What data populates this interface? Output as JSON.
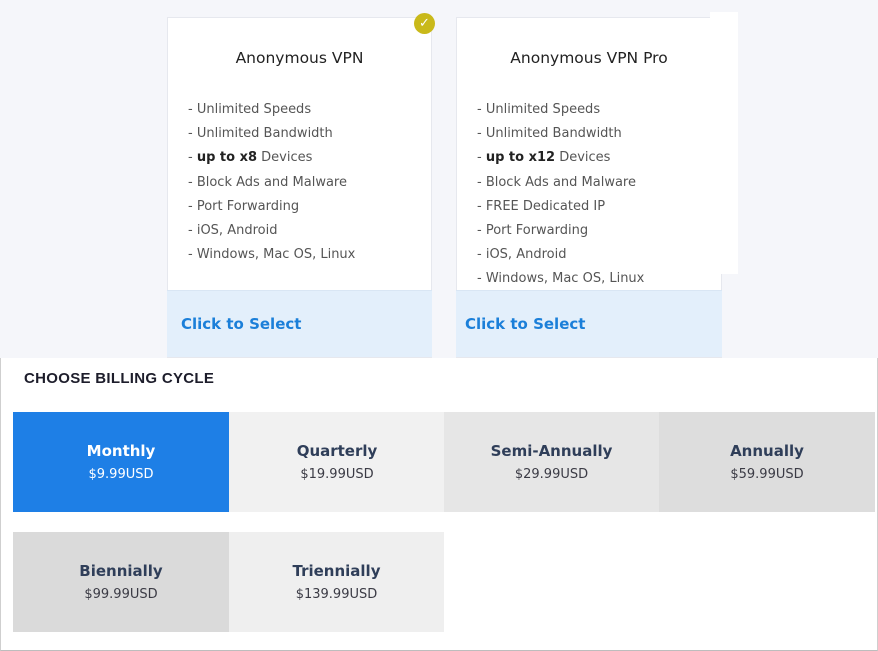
{
  "plans": [
    {
      "title": "Anonymous VPN",
      "features": [
        {
          "prefix": "- ",
          "text": "Unlimited Speeds"
        },
        {
          "prefix": "- ",
          "text": "Unlimited Bandwidth"
        },
        {
          "prefix": "- ",
          "bold": "up to x8",
          "text": " Devices"
        },
        {
          "prefix": "- ",
          "text": "Block Ads and Malware"
        },
        {
          "prefix": "- ",
          "text": "Port Forwarding"
        },
        {
          "prefix": "- ",
          "text": "iOS, Android"
        },
        {
          "prefix": "- ",
          "text": "Windows, Mac OS, Linux"
        }
      ],
      "select_label": "Click to Select",
      "selected": true
    },
    {
      "title": "Anonymous VPN Pro",
      "features": [
        {
          "prefix": "- ",
          "text": "Unlimited Speeds"
        },
        {
          "prefix": "- ",
          "text": "Unlimited Bandwidth"
        },
        {
          "prefix": "- ",
          "bold": "up to x12",
          "text": " Devices"
        },
        {
          "prefix": "- ",
          "text": "Block Ads and Malware"
        },
        {
          "prefix": "- ",
          "text": "FREE Dedicated IP"
        },
        {
          "prefix": "- ",
          "text": "Port Forwarding"
        },
        {
          "prefix": "- ",
          "text": "iOS, Android"
        },
        {
          "prefix": "- ",
          "text": "Windows, Mac OS, Linux"
        }
      ],
      "select_label": "Click to Select",
      "selected": false
    }
  ],
  "selected_check": {
    "icon": "checkmark-icon",
    "glyph": "✓",
    "color": "#c9b91a"
  },
  "billing": {
    "heading": "CHOOSE BILLING CYCLE",
    "options": [
      {
        "name": "Monthly",
        "price": "$9.99USD",
        "active": true
      },
      {
        "name": "Quarterly",
        "price": "$19.99USD",
        "active": false
      },
      {
        "name": "Semi-Annually",
        "price": "$29.99USD",
        "active": false
      },
      {
        "name": "Annually",
        "price": "$59.99USD",
        "active": false
      },
      {
        "name": "Biennially",
        "price": "$99.99USD",
        "active": false
      },
      {
        "name": "Triennially",
        "price": "$139.99USD",
        "active": false
      }
    ]
  },
  "colors": {
    "accent": "#1e7fe6",
    "link": "#1b7fd9",
    "select_bg": "#e3effb",
    "check": "#c9b91a"
  }
}
